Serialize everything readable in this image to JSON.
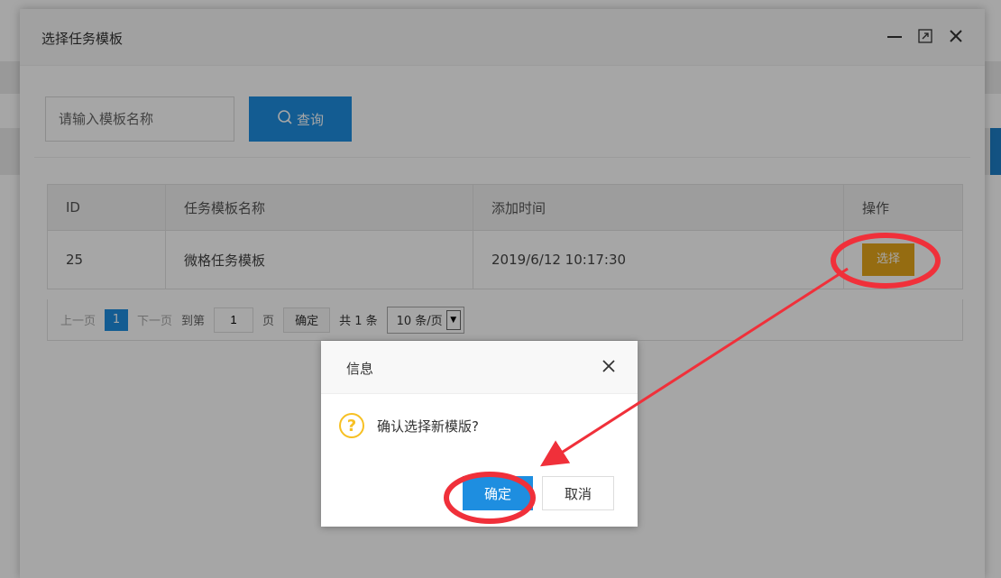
{
  "modal": {
    "title": "选择任务模板",
    "search": {
      "placeholder": "请输入模板名称",
      "button_label": "查询"
    },
    "table": {
      "columns": [
        "ID",
        "任务模板名称",
        "添加时间",
        "操作"
      ],
      "rows": [
        {
          "id": "25",
          "name": "微格任务模板",
          "time": "2019/6/12 10:17:30",
          "action": "选择"
        }
      ]
    },
    "pager": {
      "prev": "上一页",
      "current": "1",
      "next": "下一页",
      "goto_label": "到第",
      "goto_value": "1",
      "page_unit": "页",
      "confirm": "确定",
      "total": "共 1 条",
      "page_size": "10 条/页"
    }
  },
  "dialog": {
    "title": "信息",
    "message": "确认选择新模版?",
    "ok_label": "确定",
    "cancel_label": "取消"
  },
  "colors": {
    "primary": "#1e8ee0",
    "action": "#e5a71b",
    "warning_icon": "#f7c023",
    "annotation": "#f0303a"
  }
}
